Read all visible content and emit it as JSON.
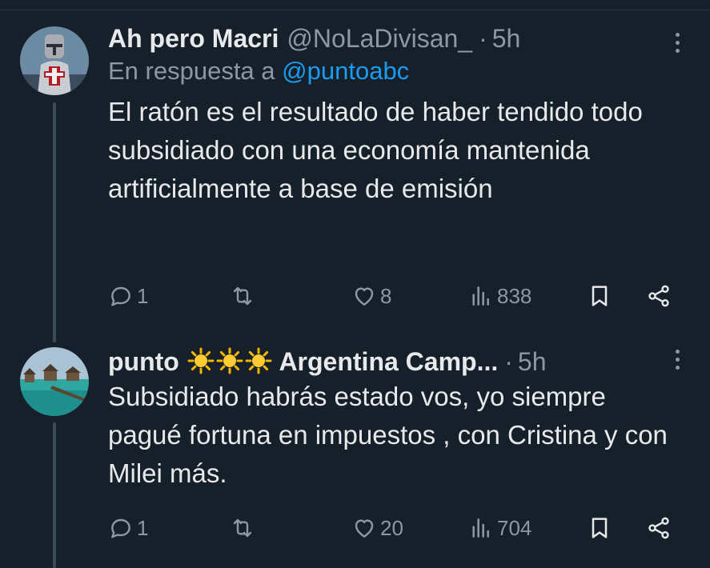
{
  "tweets": [
    {
      "name": "Ah pero Macri",
      "handle": "@NoLaDivisan_",
      "separator": "·",
      "time": "5h",
      "reply_prefix": "En respuesta a",
      "reply_mention": "@puntoabc",
      "text": "El ratón es el resultado de haber tendido todo subsidiado con una economía mantenida artificialmente a base de emisión",
      "replies": "1",
      "likes": "8",
      "views": "838"
    },
    {
      "name_prefix": "punto",
      "name_suffix": "Argentina Camp...",
      "separator": "·",
      "time": "5h",
      "text": "Subsidiado habrás estado vos, yo siempre pagué fortuna en impuestos , con Cristina y con Milei más.",
      "replies": "1",
      "likes": "20",
      "views": "704"
    }
  ],
  "icons": {
    "reply": "speech-bubble-icon",
    "retweet": "repost-arrows-icon",
    "like": "heart-icon",
    "views": "bar-chart-icon",
    "bookmark": "bookmark-icon",
    "share": "share-icon",
    "more": "vertical-dots-icon",
    "sun": "sun-emoji"
  },
  "colors": {
    "background": "#15202b",
    "text": "#e7e9ea",
    "muted": "#8b98a5",
    "link": "#1d9bf0",
    "thread_line": "#3d4a57"
  }
}
